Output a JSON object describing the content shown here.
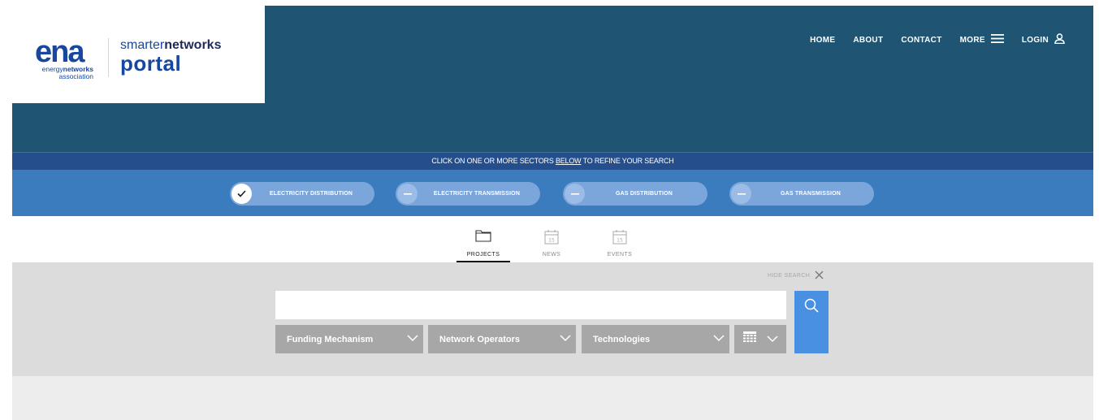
{
  "header": {
    "logo": {
      "ena_letters": "ena",
      "ena_line1_prefix": "energy",
      "ena_line1_bold": "networks",
      "ena_line2": "association",
      "portal_prefix": "smarter",
      "portal_bold": "networks",
      "portal_word": "portal"
    },
    "nav": {
      "home": "HOME",
      "about": "ABOUT",
      "contact": "CONTACT",
      "more": "MORE",
      "login": "LOGIN"
    },
    "colors": {
      "header_bg": "#1f5573",
      "logo_blue": "#17479e"
    }
  },
  "sector_banner": {
    "before": "CLICK ON ONE OR MORE SECTORS ",
    "link": "BELOW",
    "after": " TO REFINE YOUR SEARCH"
  },
  "sectors": [
    {
      "label": "ELECTRICITY DISTRIBUTION",
      "selected": true,
      "icon": "check-icon"
    },
    {
      "label": "ELECTRICITY TRANSMISSION",
      "selected": false,
      "icon": "minus-icon"
    },
    {
      "label": "GAS DISTRIBUTION",
      "selected": false,
      "icon": "minus-icon"
    },
    {
      "label": "GAS TRANSMISSION",
      "selected": false,
      "icon": "minus-icon"
    }
  ],
  "tabs": [
    {
      "label": "PROJECTS",
      "icon": "folder-icon",
      "active": true
    },
    {
      "label": "NEWS",
      "icon": "calendar-icon",
      "calendar_day": "15",
      "active": false
    },
    {
      "label": "EVENTS",
      "icon": "calendar-icon",
      "calendar_day": "15",
      "active": false
    }
  ],
  "search": {
    "hide_label": "HIDE SEARCH",
    "input_value": "",
    "placeholder": "",
    "dropdowns": {
      "funding": "Funding Mechanism",
      "operators": "Network Operators",
      "technologies": "Technologies"
    },
    "accent": "#4a90e2"
  }
}
